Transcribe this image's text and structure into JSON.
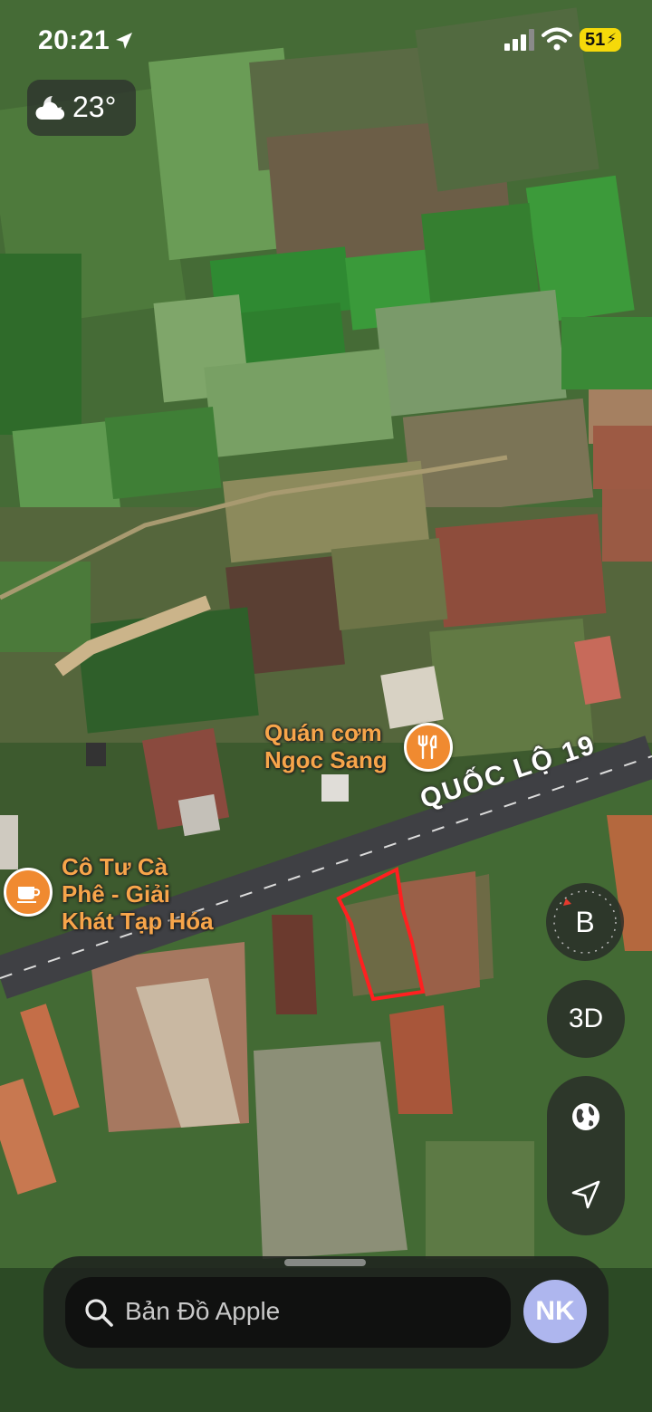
{
  "status_bar": {
    "time": "20:21",
    "battery": "51"
  },
  "weather": {
    "temperature": "23°",
    "icon": "partly-cloudy-night-icon"
  },
  "pois": [
    {
      "label_line1": "Quán cơm",
      "label_line2": "Ngọc Sang",
      "icon": "restaurant-icon",
      "color": "#f08a30"
    },
    {
      "label_line1": "Cô Tư Cà",
      "label_line2": "Phê - Giải",
      "label_line3": "Khát Tạp Hóa",
      "icon": "cafe-icon",
      "color": "#f08a30"
    }
  ],
  "road": {
    "name": "QUỐC LỘ 19"
  },
  "controls": {
    "compass_letter": "B",
    "three_d_label": "3D"
  },
  "search": {
    "placeholder": "Bản Đồ Apple",
    "avatar_initials": "NK"
  },
  "colors": {
    "poi_orange": "#f08a30",
    "boundary_red": "#ff2020",
    "battery_yellow": "#f5d90a",
    "avatar": "#aeb6ee"
  }
}
